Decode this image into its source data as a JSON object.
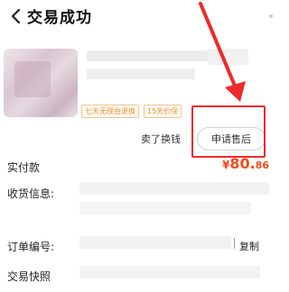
{
  "header": {
    "title": "交易成功",
    "back_icon": "back-chevron-icon",
    "more_icon": "more-icon"
  },
  "item": {
    "tags": [
      "七天无理由退换",
      "15天价保"
    ]
  },
  "actions": {
    "sell_label": "卖了换钱",
    "after_sale_label": "申请售后",
    "highlight_color": "#ee2a2a"
  },
  "payment": {
    "label": "实付款",
    "currency": "¥",
    "amount_int": "80.",
    "amount_dec": "86",
    "amount_color": "#f24a1c"
  },
  "shipping": {
    "label": "收货信息:"
  },
  "order": {
    "label": "订单编号:",
    "copy_label": "复制"
  },
  "snapshot": {
    "label": "交易快照"
  }
}
